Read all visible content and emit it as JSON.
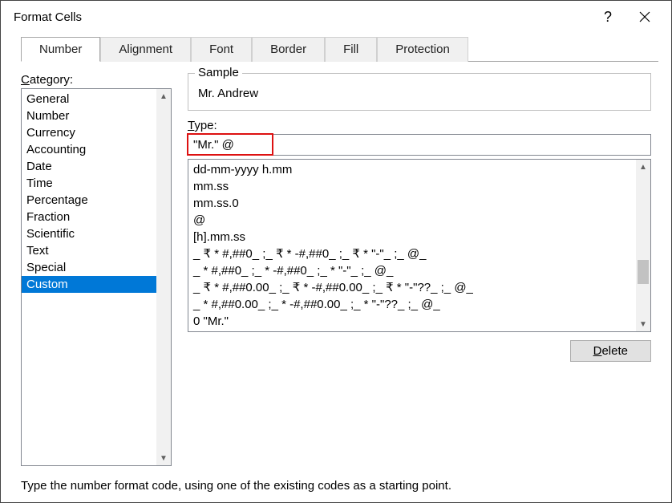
{
  "window": {
    "title": "Format Cells",
    "help_symbol": "?",
    "close_label": "Close"
  },
  "tabs": [
    {
      "label": "Number",
      "active": true
    },
    {
      "label": "Alignment",
      "active": false
    },
    {
      "label": "Font",
      "active": false
    },
    {
      "label": "Border",
      "active": false
    },
    {
      "label": "Fill",
      "active": false
    },
    {
      "label": "Protection",
      "active": false
    }
  ],
  "labels": {
    "category": "Category:",
    "category_underline": "C",
    "sample": "Sample",
    "type": "Type:",
    "type_underline": "T",
    "delete": "Delete",
    "delete_underline": "D"
  },
  "categories": [
    "General",
    "Number",
    "Currency",
    "Accounting",
    "Date",
    "Time",
    "Percentage",
    "Fraction",
    "Scientific",
    "Text",
    "Special",
    "Custom"
  ],
  "selected_category_index": 11,
  "sample_value": "Mr. Andrew",
  "type_value": "\"Mr.\" @",
  "format_codes": [
    "dd-mm-yyyy h.mm",
    "mm.ss",
    "mm.ss.0",
    "@",
    "[h].mm.ss",
    "_ ₹ * #,##0_ ;_ ₹ * -#,##0_ ;_ ₹ * \"-\"_ ;_ @_",
    "_ * #,##0_ ;_ * -#,##0_ ;_ * \"-\"_ ;_ @_",
    "_ ₹ * #,##0.00_ ;_ ₹ * -#,##0.00_ ;_ ₹ * \"-\"??_ ;_ @_",
    "_ * #,##0.00_ ;_ * -#,##0.00_ ;_ * \"-\"??_ ;_ @_",
    "0 \"Mr.\"",
    "\"Mr.\" @"
  ],
  "hint": "Type the number format code, using one of the existing codes as a starting point."
}
